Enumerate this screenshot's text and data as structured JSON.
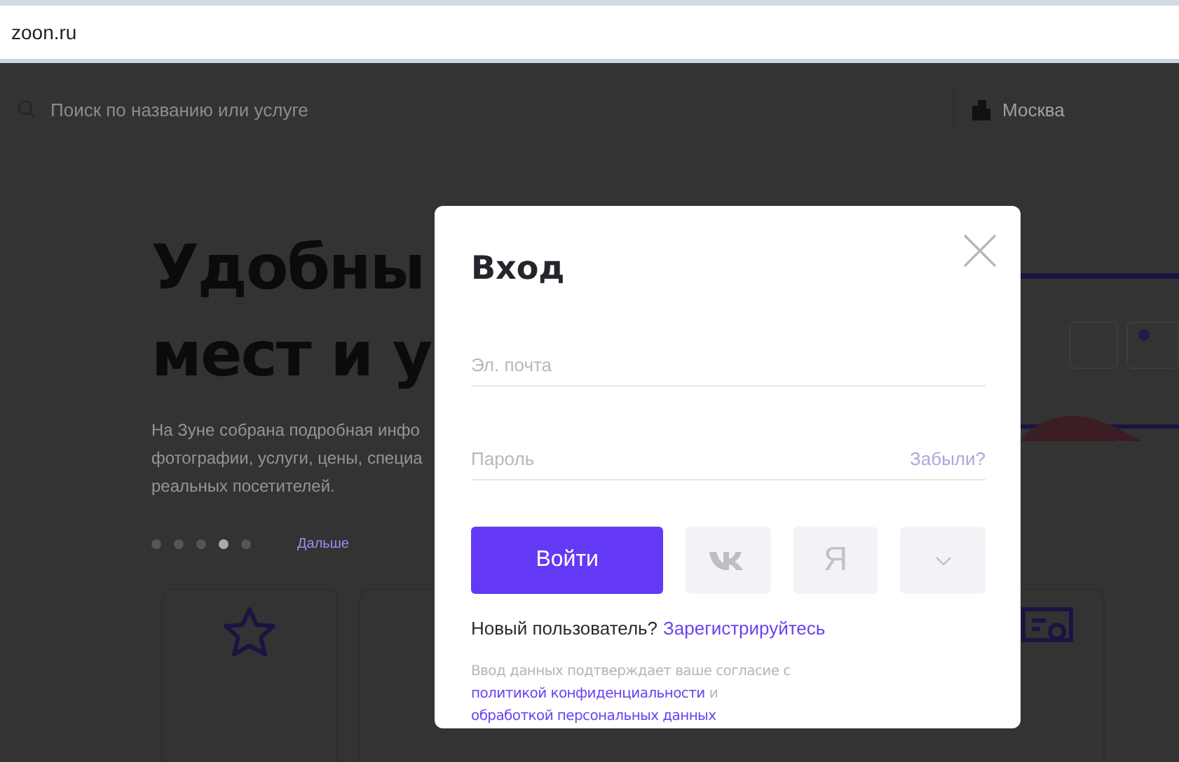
{
  "browser": {
    "url": "zoon.ru"
  },
  "header": {
    "search": {
      "placeholder": "Поиск по названию или услуге"
    },
    "city": "Москва"
  },
  "hero": {
    "title_lines": [
      "Удобны",
      "мест и у"
    ],
    "description_lines": [
      "На Зуне собрана подробная инфо",
      "фотографии, услуги, цены, специа",
      "реальных посетителей."
    ],
    "carousel": [
      {
        "selected": false
      },
      {
        "selected": false
      },
      {
        "selected": false
      },
      {
        "selected": true
      },
      {
        "selected": false
      }
    ],
    "next_link": "Дальше"
  },
  "modal": {
    "title": "Вход",
    "fields": [
      {
        "placeholder": "Эл. почта"
      },
      {
        "placeholder": "Пароль",
        "link": "Забыли?"
      }
    ],
    "submit": "Войти",
    "social": [
      {
        "kind": "vk"
      },
      {
        "kind": "yandex",
        "label": "Я"
      },
      {
        "kind": "more"
      }
    ],
    "register_prompt": "Новый пользователь?",
    "register_link": "Зарегистрируйтесь",
    "consent": [
      {
        "kind": "text",
        "text": "Ввод данных подтверждает ваше согласие с"
      },
      {
        "kind": "link",
        "text": "политикой конфиденциальности"
      },
      {
        "kind": "text",
        "text": "и"
      },
      {
        "kind": "link",
        "text": "обработкой персональных данных"
      }
    ]
  }
}
